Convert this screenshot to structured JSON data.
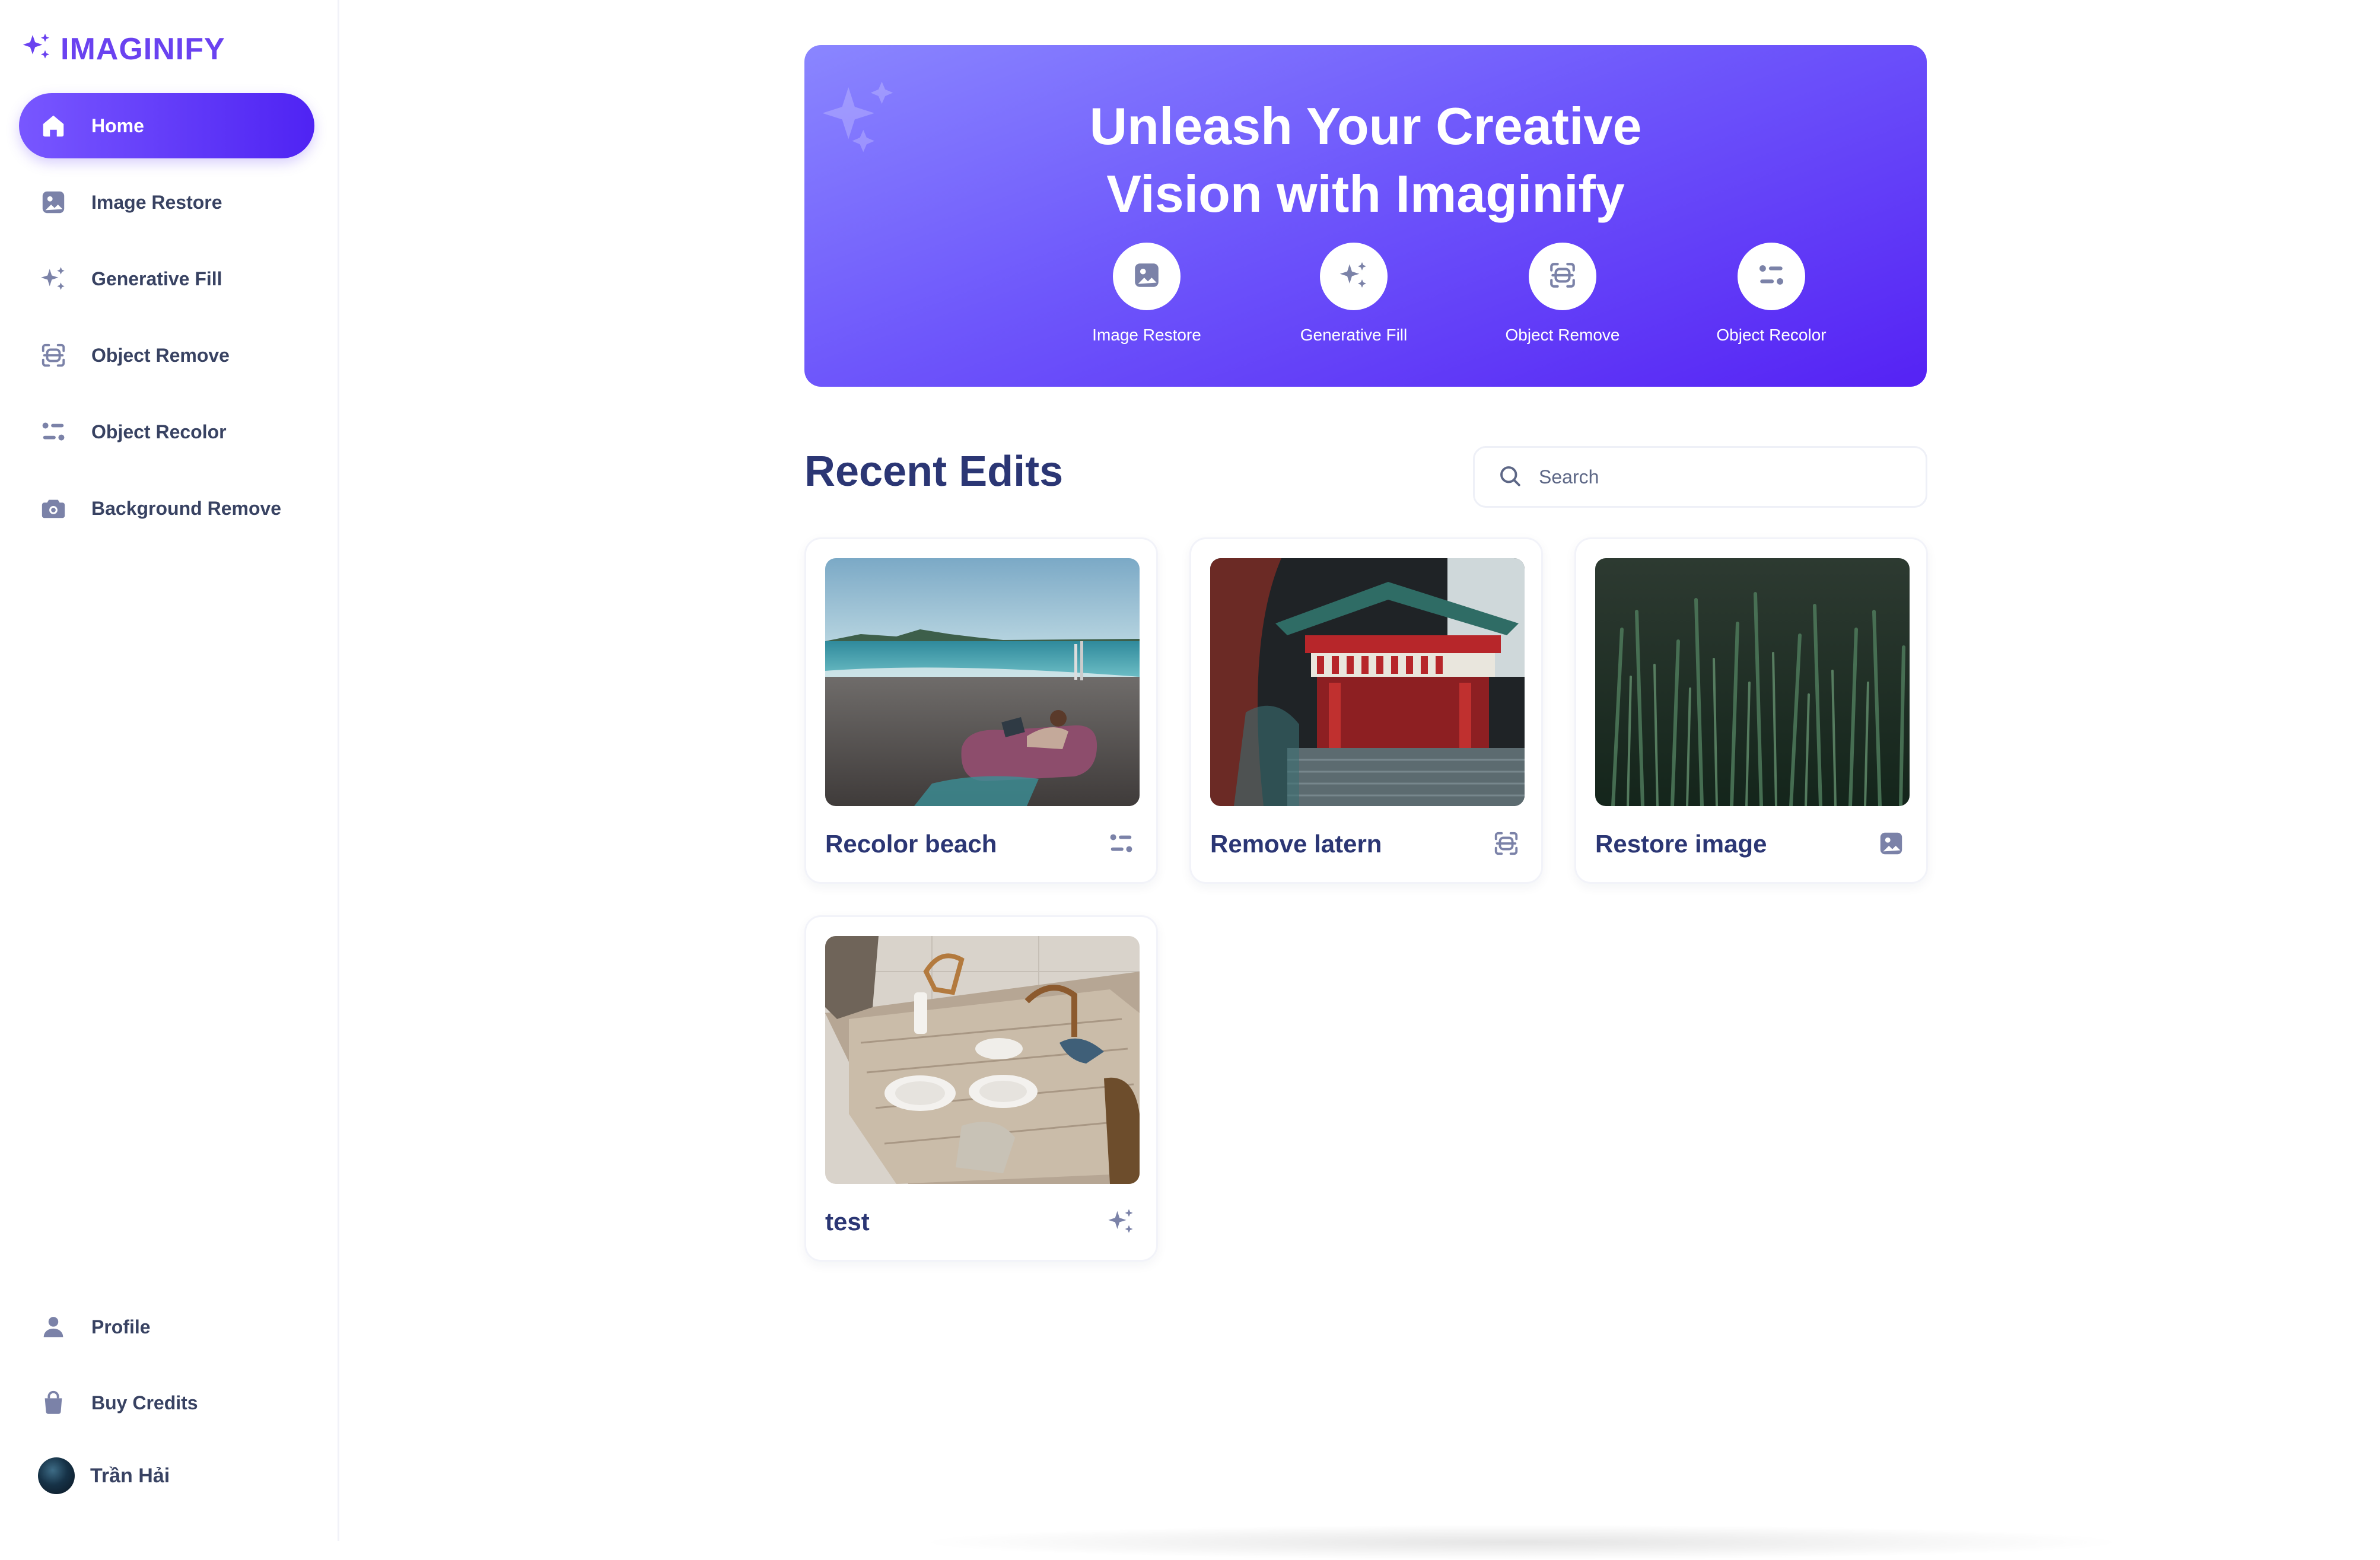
{
  "app": {
    "name": "IMAGINIFY",
    "logo_icon": "sparkles-icon",
    "brand_color": "#6a42f0",
    "accent_gradient": [
      "#7857ff",
      "#4f23f3"
    ]
  },
  "sidebar": {
    "items": [
      {
        "label": "Home",
        "icon": "home-icon",
        "active": true
      },
      {
        "label": "Image Restore",
        "icon": "image-icon"
      },
      {
        "label": "Generative Fill",
        "icon": "sparkles-icon"
      },
      {
        "label": "Object Remove",
        "icon": "scan-icon"
      },
      {
        "label": "Object Recolor",
        "icon": "filter-icon"
      },
      {
        "label": "Background Remove",
        "icon": "camera-icon"
      }
    ],
    "bottom": [
      {
        "label": "Profile",
        "icon": "user-icon"
      },
      {
        "label": "Buy Credits",
        "icon": "bag-icon"
      }
    ],
    "user": {
      "name": "Trần Hải"
    }
  },
  "banner": {
    "title_line1": "Unleash Your Creative",
    "title_line2": "Vision with Imaginify",
    "shortcuts": [
      {
        "label": "Image Restore",
        "icon": "image-icon"
      },
      {
        "label": "Generative Fill",
        "icon": "sparkles-icon"
      },
      {
        "label": "Object Remove",
        "icon": "scan-icon"
      },
      {
        "label": "Object Recolor",
        "icon": "filter-icon"
      }
    ]
  },
  "recent": {
    "title": "Recent Edits",
    "search_placeholder": "Search",
    "cards": [
      {
        "title": "Recolor beach",
        "icon": "filter-icon"
      },
      {
        "title": "Remove latern",
        "icon": "scan-icon"
      },
      {
        "title": "Restore image",
        "icon": "image-icon"
      },
      {
        "title": "test",
        "icon": "sparkles-icon"
      }
    ]
  }
}
